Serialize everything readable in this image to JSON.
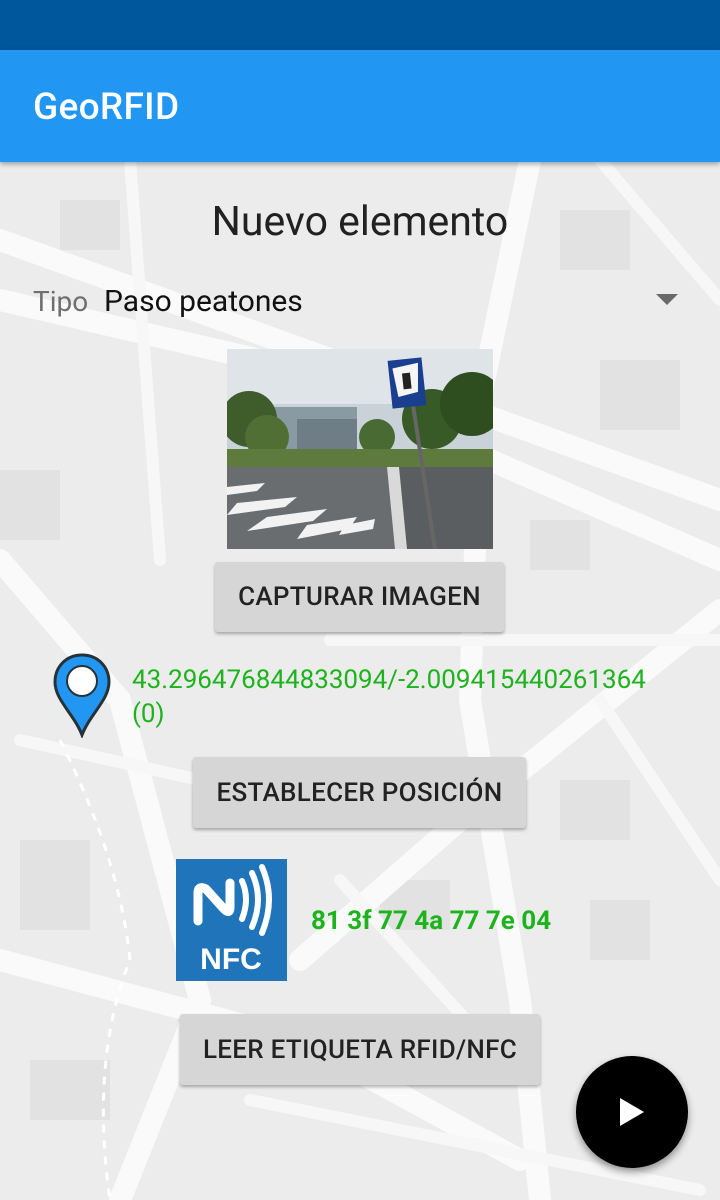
{
  "app": {
    "title": "GeoRFID"
  },
  "form": {
    "title": "Nuevo elemento",
    "type_label": "Tipo",
    "type_value": "Paso peatones"
  },
  "image": {
    "capture_button": "CAPTURAR IMAGEN"
  },
  "location": {
    "coordinates": "43.296476844833094/-2.009415440261364 (0)",
    "set_button": "ESTABLECER POSICIÓN",
    "icon": "map-pin-icon"
  },
  "tag": {
    "icon": "nfc-logo-icon",
    "id": "81 3f 77 4a 77 7e 04",
    "read_button": "LEER ETIQUETA RFID/NFC"
  },
  "fab": {
    "icon": "play-icon"
  },
  "colors": {
    "status_bar": "#01579b",
    "app_bar": "#2196f3",
    "value_green": "#1db31d",
    "nfc_blue": "#1f74ba",
    "pin_blue": "#2196f3"
  }
}
